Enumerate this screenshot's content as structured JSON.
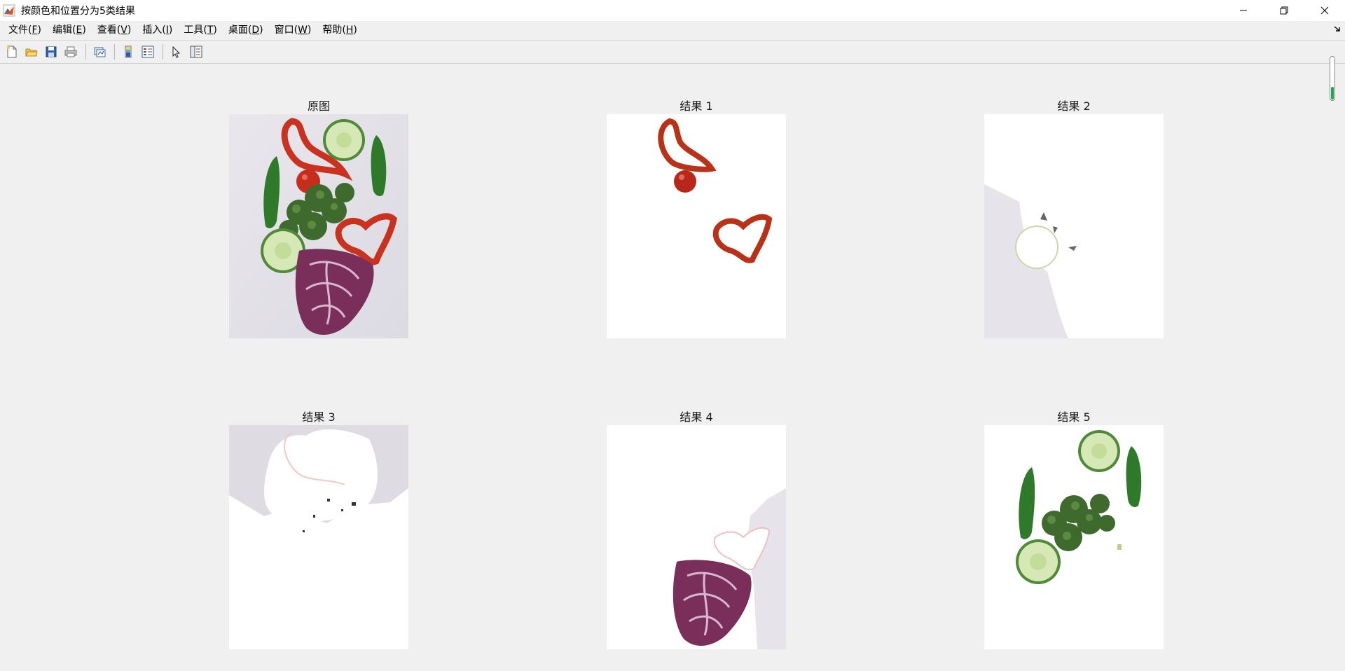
{
  "window": {
    "title": "按颜色和位置分为5类结果",
    "controls": [
      "minimize",
      "restore",
      "close"
    ]
  },
  "menubar": {
    "items": [
      {
        "label": "文件(",
        "key": "F",
        "tail": ")"
      },
      {
        "label": "编辑(",
        "key": "E",
        "tail": ")"
      },
      {
        "label": "查看(",
        "key": "V",
        "tail": ")"
      },
      {
        "label": "插入(",
        "key": "I",
        "tail": ")"
      },
      {
        "label": "工具(",
        "key": "T",
        "tail": ")"
      },
      {
        "label": "桌面(",
        "key": "D",
        "tail": ")"
      },
      {
        "label": "窗口(",
        "key": "W",
        "tail": ")"
      },
      {
        "label": "帮助(",
        "key": "H",
        "tail": ")"
      }
    ]
  },
  "toolbar": {
    "icons": [
      "new-figure-icon",
      "open-file-icon",
      "save-icon",
      "print-icon",
      "link-plot-icon",
      "colorbar-icon",
      "legend-icon",
      "edit-plot-icon",
      "property-inspector-icon"
    ]
  },
  "subplots": [
    {
      "title": "原图",
      "content": "original vegetables"
    },
    {
      "title": "结果 1",
      "content": "red pepper and tomato cluster"
    },
    {
      "title": "结果 2",
      "content": "background left cluster"
    },
    {
      "title": "结果 3",
      "content": "upper background cluster"
    },
    {
      "title": "结果 4",
      "content": "red cabbage cluster"
    },
    {
      "title": "结果 5",
      "content": "green vegetables cluster"
    }
  ],
  "colors": {
    "background": "#f0f0f0",
    "axes": "#ffffff",
    "red_pepper": "#c8321e",
    "green": "#3c7a2a",
    "cabbage": "#7a2e5a",
    "cucumber": "#cfe3a8"
  }
}
